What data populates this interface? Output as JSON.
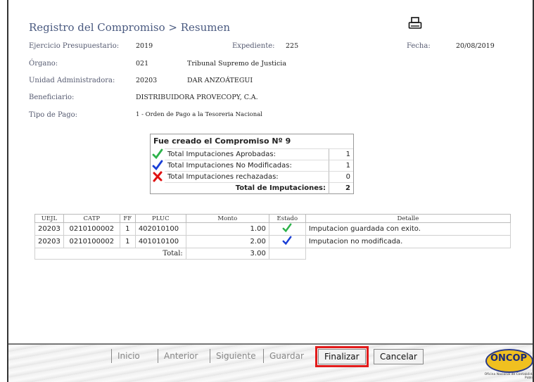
{
  "header": {
    "title": "Registro del Compromiso > Resumen"
  },
  "fields": {
    "ejercicio": {
      "label": "Ejercicio Presupuestario:",
      "value": "2019"
    },
    "expediente": {
      "label": "Expediente:",
      "value": "225"
    },
    "fecha": {
      "label": "Fecha:",
      "value": "20/08/2019"
    },
    "organo": {
      "label": "Órgano:",
      "code": "021",
      "name": "Tribunal Supremo de Justicia"
    },
    "unidad": {
      "label": "Unidad Administradora:",
      "code": "20203",
      "name": "DAR ANZOÁTEGUI"
    },
    "beneficiario": {
      "label": "Beneficiario:",
      "value": "DISTRIBUIDORA PROVECOPY, C.A."
    },
    "tipo_pago": {
      "label": "Tipo de Pago:",
      "value": "1 - Orden de Pago a la Tesoreria Nacional"
    }
  },
  "summary": {
    "title": "Fue creado el Compromiso Nº 9",
    "rows": [
      {
        "icon": "green-check-icon",
        "label": "Total Imputaciones Aprobadas:",
        "value": "1"
      },
      {
        "icon": "blue-check-icon",
        "label": "Total Imputaciones No Modificadas:",
        "value": "1"
      },
      {
        "icon": "red-x-icon",
        "label": "Total Imputaciones rechazadas:",
        "value": "0"
      }
    ],
    "total_label": "Total de Imputaciones:",
    "total_value": "2"
  },
  "table": {
    "headers": [
      "UEJL",
      "CATP",
      "FF",
      "PLUC",
      "Monto",
      "Estado",
      "Detalle"
    ],
    "rows": [
      {
        "uejl": "20203",
        "catp": "0210100002",
        "ff": "1",
        "pluc": "402010100",
        "monto": "1.00",
        "estado": "green-check-icon",
        "detalle": "Imputacion guardada con exito."
      },
      {
        "uejl": "20203",
        "catp": "0210100002",
        "ff": "1",
        "pluc": "401010100",
        "monto": "2.00",
        "estado": "blue-check-icon",
        "detalle": "Imputacion no modificada."
      }
    ],
    "total_label": "Total:",
    "total_value": "3.00"
  },
  "toolbar": {
    "inicio": "Inicio",
    "anterior": "Anterior",
    "siguiente": "Siguiente",
    "guardar": "Guardar",
    "finalizar": "Finalizar",
    "cancelar": "Cancelar"
  },
  "logo": {
    "text": "ONCOP",
    "subtitle": "Oficina Nacional de Contabilidad Pública"
  },
  "colors": {
    "accent": "#e21b1b",
    "check_green": "#2db24a",
    "check_blue": "#1a3fd6",
    "x_red": "#e01010"
  }
}
